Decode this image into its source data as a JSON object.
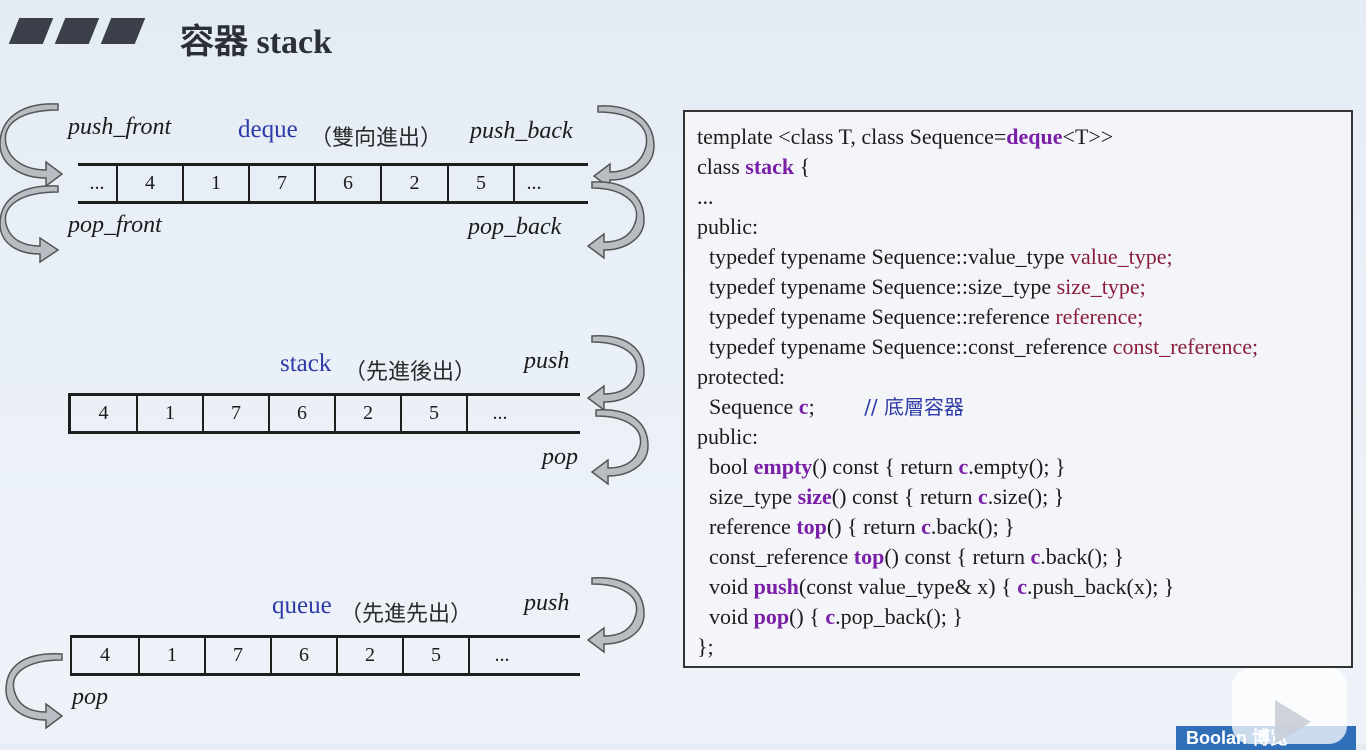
{
  "title": "容器 stack",
  "deque": {
    "push_front": "push_front",
    "pop_front": "pop_front",
    "push_back": "push_back",
    "pop_back": "pop_back",
    "name": "deque",
    "desc": "（雙向進出）",
    "cells": [
      "...",
      "4",
      "1",
      "7",
      "6",
      "2",
      "5",
      "..."
    ]
  },
  "stack": {
    "name": "stack",
    "desc": "（先進後出）",
    "push": "push",
    "pop": "pop",
    "cells": [
      "4",
      "1",
      "7",
      "6",
      "2",
      "5",
      "..."
    ]
  },
  "queue": {
    "name": "queue",
    "desc": "（先進先出）",
    "push": "push",
    "pop": "pop",
    "cells": [
      "4",
      "1",
      "7",
      "6",
      "2",
      "5",
      "..."
    ]
  },
  "code": {
    "l1a": "template <class T, class Sequence=",
    "l1b": "deque",
    "l1c": "<T>>",
    "l2a": "class ",
    "l2b": "stack",
    "l2c": " {",
    "l3": "...",
    "l4": "public:",
    "l5a": "typedef typename Sequence::value_type ",
    "l5b": "value_type;",
    "l6a": "typedef typename Sequence::size_type ",
    "l6b": "size_type;",
    "l7a": "typedef typename Sequence::reference ",
    "l7b": "reference;",
    "l8a": "typedef typename Sequence::const_reference ",
    "l8b": "const_reference;",
    "l9": "protected:",
    "l10a": "Sequence ",
    "l10b": "c",
    "l10c": ";         ",
    "l10d": "// 底層容器",
    "l11": "public:",
    "l12a": "bool ",
    "l12b": "empty",
    "l12c": "() const { return ",
    "l12d": "c",
    "l12e": ".empty(); }",
    "l13a": "size_type ",
    "l13b": "size",
    "l13c": "() const { return ",
    "l13d": "c",
    "l13e": ".size(); }",
    "l14a": "reference ",
    "l14b": "top",
    "l14c": "() { return ",
    "l14d": "c",
    "l14e": ".back(); }",
    "l15a": "const_reference ",
    "l15b": "top",
    "l15c": "() const { return ",
    "l15d": "c",
    "l15e": ".back(); }",
    "l16a": "void ",
    "l16b": "push",
    "l16c": "(const value_type& x) { ",
    "l16d": "c",
    "l16e": ".push_back(x); }",
    "l17a": "void ",
    "l17b": "pop",
    "l17c": "() { ",
    "l17d": "c",
    "l17e": ".pop_back(); }",
    "l18": "};"
  },
  "watermark": "Boolan 博览"
}
